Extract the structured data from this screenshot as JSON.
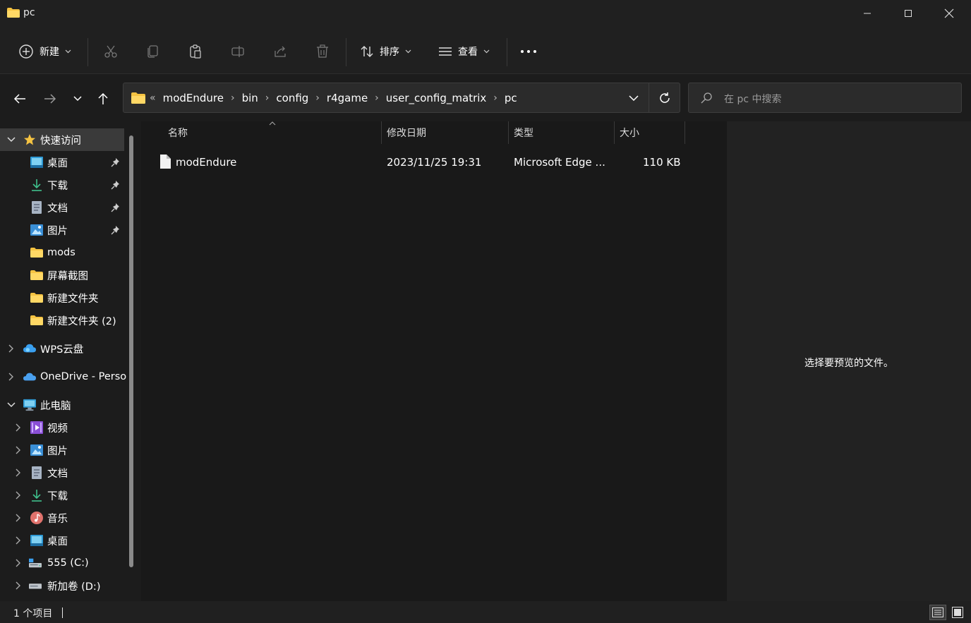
{
  "window": {
    "title": "pc",
    "controls": {
      "minimize": "minimize-icon",
      "maximize": "maximize-icon",
      "close": "close-icon"
    }
  },
  "toolbar": {
    "new_label": "新建",
    "sort_label": "排序",
    "view_label": "查看",
    "icons": [
      "cut-icon",
      "copy-icon",
      "paste-icon",
      "rename-icon",
      "share-icon",
      "delete-icon",
      "more-icon"
    ]
  },
  "address": {
    "overflow": "«",
    "crumbs": [
      "modEndure",
      "bin",
      "config",
      "r4game",
      "user_config_matrix",
      "pc"
    ]
  },
  "search": {
    "placeholder": "在 pc 中搜索"
  },
  "sidebar": {
    "quick_access": {
      "label": "快速访问",
      "items": [
        {
          "label": "桌面",
          "icon": "desktop-icon",
          "pinned": true
        },
        {
          "label": "下载",
          "icon": "download-icon",
          "pinned": true
        },
        {
          "label": "文档",
          "icon": "document-icon",
          "pinned": true
        },
        {
          "label": "图片",
          "icon": "pictures-icon",
          "pinned": true
        },
        {
          "label": "mods",
          "icon": "folder-icon",
          "pinned": false
        },
        {
          "label": "屏幕截图",
          "icon": "folder-icon",
          "pinned": false
        },
        {
          "label": "新建文件夹",
          "icon": "folder-icon",
          "pinned": false
        },
        {
          "label": "新建文件夹 (2)",
          "icon": "folder-icon",
          "pinned": false
        }
      ]
    },
    "wps": {
      "label": "WPS云盘"
    },
    "onedrive": {
      "label": "OneDrive - Perso"
    },
    "this_pc": {
      "label": "此电脑",
      "items": [
        {
          "label": "视频",
          "icon": "videos-icon"
        },
        {
          "label": "图片",
          "icon": "pictures-icon"
        },
        {
          "label": "文档",
          "icon": "document-icon"
        },
        {
          "label": "下载",
          "icon": "download-icon"
        },
        {
          "label": "音乐",
          "icon": "music-icon"
        },
        {
          "label": "桌面",
          "icon": "desktop-icon"
        },
        {
          "label": "555 (C:)",
          "icon": "drive-c-icon"
        },
        {
          "label": "新加卷 (D:)",
          "icon": "drive-d-icon"
        }
      ]
    }
  },
  "filelist": {
    "columns": [
      "名称",
      "修改日期",
      "类型",
      "大小"
    ],
    "rows": [
      {
        "name": "modEndure",
        "modified": "2023/11/25 19:31",
        "type": "Microsoft Edge ...",
        "size": "110 KB"
      }
    ]
  },
  "preview": {
    "message": "选择要预览的文件。"
  },
  "status": {
    "item_count": "1 个项目"
  },
  "colors": {
    "background": "#1c1c1c",
    "chrome": "#202020",
    "folder": "#f5c342",
    "selected": "#3a3a3a"
  }
}
